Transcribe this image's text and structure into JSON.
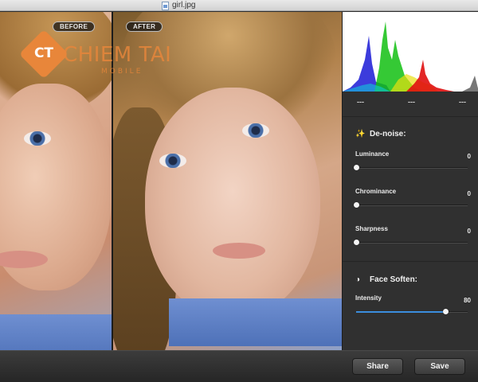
{
  "window": {
    "title": "girl.jpg"
  },
  "photo": {
    "before_label": "BEFORE",
    "after_label": "AFTER",
    "watermark": {
      "badge": "CT",
      "name": "CHIEM TAI",
      "sub": "MOBILE"
    }
  },
  "histogram": {
    "readouts": [
      "---",
      "---",
      "---"
    ],
    "colors": {
      "red": "#e01010",
      "green": "#12c012",
      "blue": "#1a1ad6",
      "yellow": "#e8e010",
      "cyan": "#10c8d8"
    }
  },
  "denoise": {
    "title": "De-noise:",
    "icon": "magic-wand-icon",
    "sliders": [
      {
        "label": "Luminance",
        "value": "0",
        "level": 0
      },
      {
        "label": "Chrominance",
        "value": "0",
        "level": 0
      },
      {
        "label": "Sharpness",
        "value": "0",
        "level": 0
      }
    ]
  },
  "face_soften": {
    "title": "Face Soften:",
    "icon": "face-soften-icon",
    "sliders": [
      {
        "label": "Intensity",
        "value": "80",
        "level": 0.8
      }
    ]
  },
  "buttons": {
    "share": "Share",
    "save": "Save"
  },
  "accent_color": "#3b8ede"
}
